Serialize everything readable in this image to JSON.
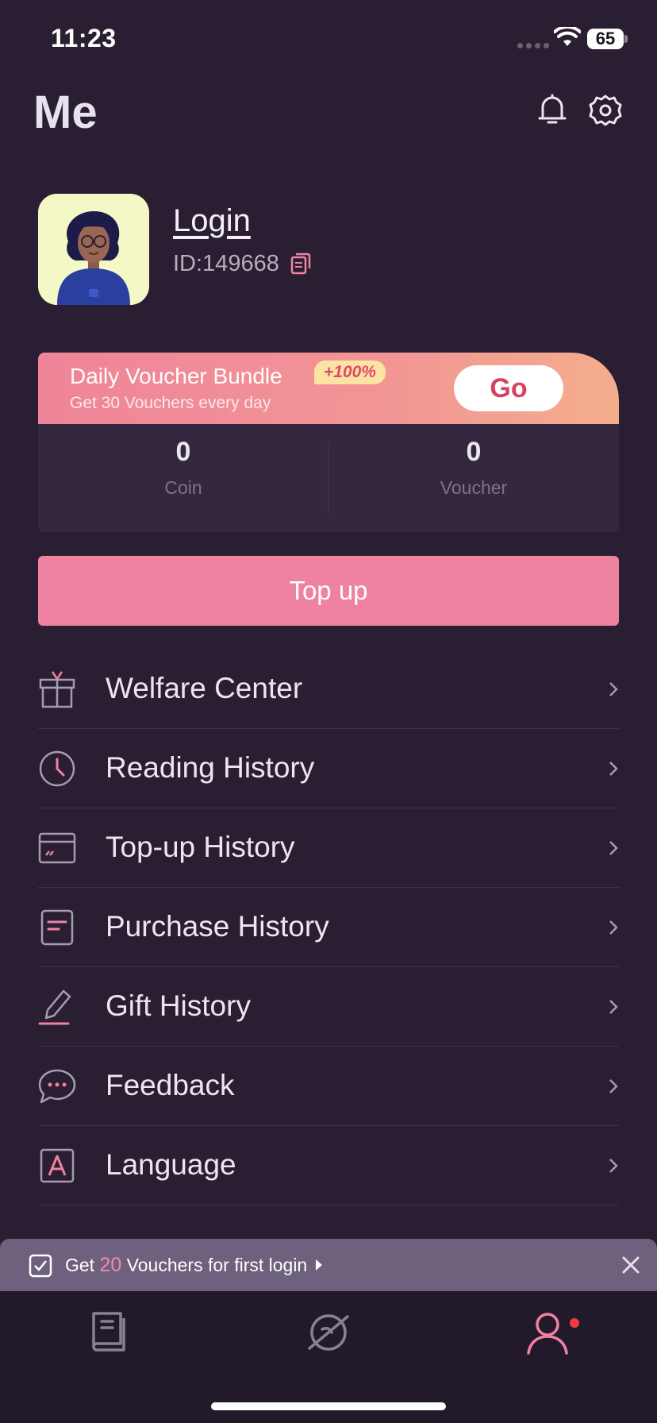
{
  "status_bar": {
    "time": "11:23",
    "battery": "65"
  },
  "header": {
    "title": "Me"
  },
  "profile": {
    "login_label": "Login",
    "user_id": "ID:149668"
  },
  "voucher_bundle": {
    "title": "Daily Voucher Bundle",
    "badge": "+100%",
    "subtitle": "Get 30 Vouchers every day",
    "go_label": "Go"
  },
  "balances": {
    "coin_value": "0",
    "coin_label": "Coin",
    "voucher_value": "0",
    "voucher_label": "Voucher"
  },
  "topup_label": "Top up",
  "menu": [
    {
      "label": "Welfare Center",
      "icon": "gift-icon"
    },
    {
      "label": "Reading History",
      "icon": "clock-icon"
    },
    {
      "label": "Top-up History",
      "icon": "card-icon"
    },
    {
      "label": "Purchase History",
      "icon": "receipt-icon"
    },
    {
      "label": "Gift History",
      "icon": "pen-icon"
    },
    {
      "label": "Feedback",
      "icon": "chat-bubble-icon"
    },
    {
      "label": "Language",
      "icon": "language-icon"
    }
  ],
  "toast": {
    "prefix": "Get",
    "count": "20",
    "suffix": "Vouchers for first login"
  },
  "tabs": [
    {
      "name": "library",
      "icon": "book-icon"
    },
    {
      "name": "discover",
      "icon": "planet-icon"
    },
    {
      "name": "me",
      "icon": "user-icon",
      "active": true
    }
  ],
  "colors": {
    "accent": "#ef82a0",
    "background": "#2a1f32",
    "badge_dot": "#ef3d47"
  }
}
